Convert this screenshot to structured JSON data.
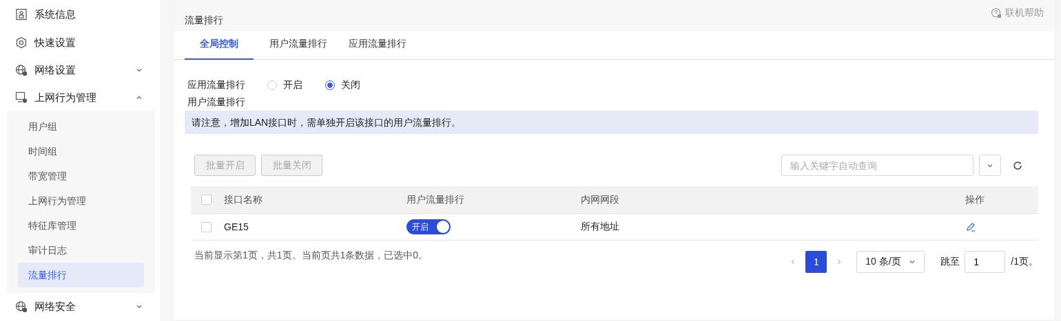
{
  "sidebar": {
    "items": [
      {
        "label": "系统信息"
      },
      {
        "label": "快速设置"
      },
      {
        "label": "网络设置",
        "expanded": false
      },
      {
        "label": "上网行为管理",
        "expanded": true,
        "children": [
          {
            "label": "用户组",
            "selected": false
          },
          {
            "label": "时间组",
            "selected": false
          },
          {
            "label": "带宽管理",
            "selected": false
          },
          {
            "label": "上网行为管理",
            "selected": false
          },
          {
            "label": "特征库管理",
            "selected": false
          },
          {
            "label": "审计日志",
            "selected": false
          },
          {
            "label": "流量排行",
            "selected": true
          }
        ]
      },
      {
        "label": "网络安全",
        "expanded": false
      }
    ]
  },
  "page": {
    "title": "流量排行",
    "help": "联机帮助"
  },
  "tabs": [
    {
      "label": "全局控制",
      "selected": true
    },
    {
      "label": "用户流量排行",
      "selected": false
    },
    {
      "label": "应用流量排行",
      "selected": false
    }
  ],
  "app_ranking": {
    "label": "应用流量排行",
    "options": [
      {
        "label": "开启",
        "selected": false
      },
      {
        "label": "关闭",
        "selected": true
      }
    ]
  },
  "user_ranking": {
    "label": "用户流量排行",
    "notice": "请注意，增加LAN接口时，需单独开启该接口的用户流量排行。"
  },
  "toolbar": {
    "buttons": [
      {
        "label": "批量开启",
        "disabled": true
      },
      {
        "label": "批量关闭",
        "disabled": true
      }
    ],
    "search": {
      "placeholder": "输入关键字自动查询"
    }
  },
  "table": {
    "select_all": {
      "checked": false
    },
    "columns": [
      "接口名称",
      "用户流量排行",
      "内网网段",
      "操作"
    ],
    "rows": [
      {
        "checked": false,
        "name": "GE15",
        "ranking": {
          "on": true,
          "label": "开启"
        },
        "subnet": "所有地址"
      }
    ]
  },
  "footer": {
    "summary": "当前显示第1页，共1页。当前页共1条数据，已选中0。",
    "pages": [
      {
        "label": "1",
        "selected": true
      }
    ],
    "page_size": "10 条/页",
    "jump_label": "跳至",
    "jump_value": "1",
    "total": "/1页。"
  }
}
